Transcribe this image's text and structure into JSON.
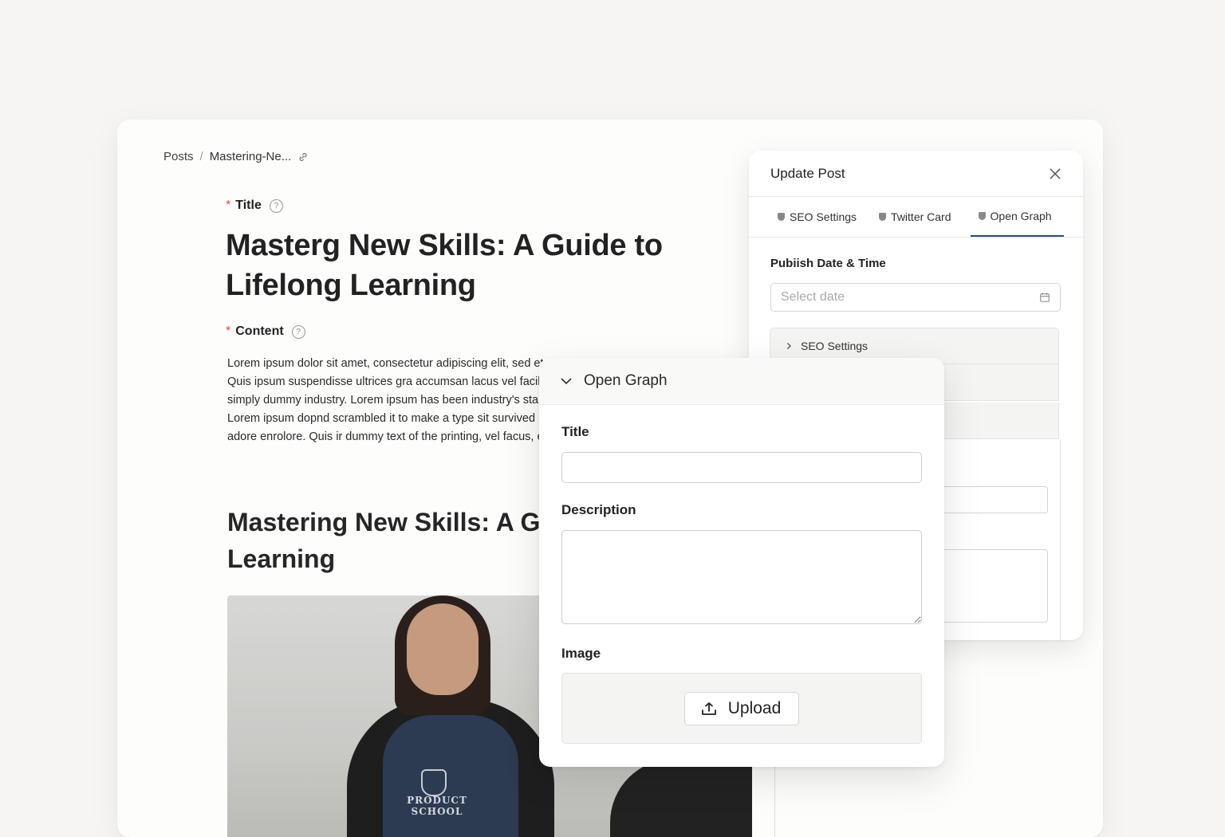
{
  "breadcrumb": {
    "root": "Posts",
    "separator": "/",
    "current": "Mastering-Ne..."
  },
  "editor": {
    "title_label": "Title",
    "title_value": "Masterg New Skills: A Guide to Lifelong Learning",
    "content_label": "Content",
    "body_text": "Lorem ipsum dolor sit amet, consectetur adipiscing elit, sed et dolore magna aliqua. Quis ipsum suspendisse ultrices gra accumsan lacus vel facilisis. Lorem ipsum is simply dummy industry. Lorem ipsum has been industry's standard dummy not only. Lorem ipsum dopnd scrambled it to make a type sit survived hctively five centurlont et adore enrolore. Quis ir dummy text of the printing, vel facus, ecciitisis. Lor",
    "content_heading": "Mastering New Skills: A Guide to Lifelong Learning",
    "image_shirt_text": "PRODUCT SCHOOL"
  },
  "update_panel": {
    "title": "Update Post",
    "tabs": [
      {
        "label": "SEO Settings"
      },
      {
        "label": "Twitter Card"
      },
      {
        "label": "Open Graph"
      }
    ],
    "publish_label": "Pubiish Date & Time",
    "date_placeholder": "Select date",
    "collapse_items": [
      {
        "label": "SEO Settings"
      }
    ]
  },
  "open_graph": {
    "header": "Open Graph",
    "title_label": "Title",
    "title_value": "",
    "description_label": "Description",
    "description_value": "",
    "image_label": "Image",
    "upload_label": "Upload"
  },
  "colors": {
    "background": "#f6f5f3",
    "required": "#e0483e",
    "active_tab": "#2b4a7a"
  }
}
